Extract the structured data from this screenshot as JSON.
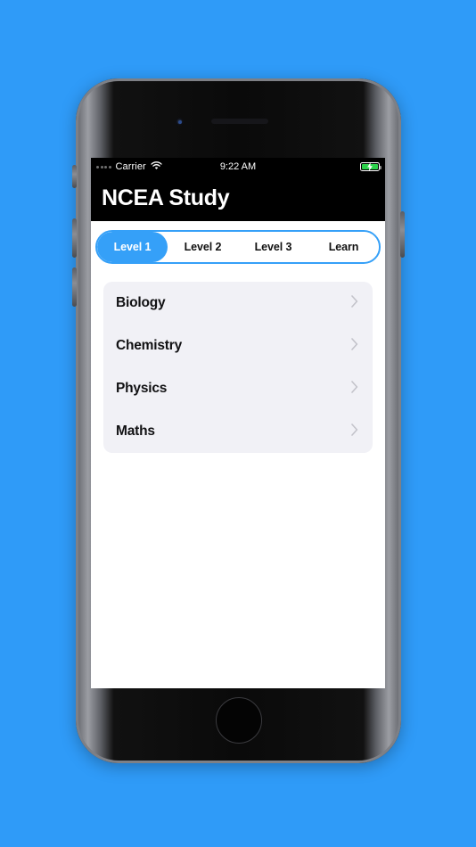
{
  "device": {
    "hardware": {
      "earpiece": "earpiece-speaker",
      "front_camera": "front-camera",
      "home_button": "home-button",
      "mute_switch": "mute-switch",
      "volume_up": "volume-up-button",
      "volume_down": "volume-down-button",
      "power_button": "power-button"
    }
  },
  "status_bar": {
    "carrier": "Carrier",
    "signal_dots": 4,
    "wifi_icon": "wifi-icon",
    "time": "9:22 AM",
    "battery_icon": "battery-charging-icon",
    "battery_color": "#2bd14a"
  },
  "nav": {
    "title": "NCEA Study"
  },
  "tabs": {
    "active_index": 0,
    "items": [
      {
        "label": "Level 1"
      },
      {
        "label": "Level 2"
      },
      {
        "label": "Level 3"
      },
      {
        "label": "Learn"
      }
    ]
  },
  "subject_list": {
    "rows": [
      {
        "label": "Biology",
        "accessory": "chevron-right-icon"
      },
      {
        "label": "Chemistry",
        "accessory": "chevron-right-icon"
      },
      {
        "label": "Physics",
        "accessory": "chevron-right-icon"
      },
      {
        "label": "Maths",
        "accessory": "chevron-right-icon"
      }
    ]
  },
  "colors": {
    "background": "#2f9bf8",
    "accent": "#35a0f8",
    "card": "#f1f1f6",
    "nav_background": "#000000",
    "chevron": "#c3c3ca"
  }
}
